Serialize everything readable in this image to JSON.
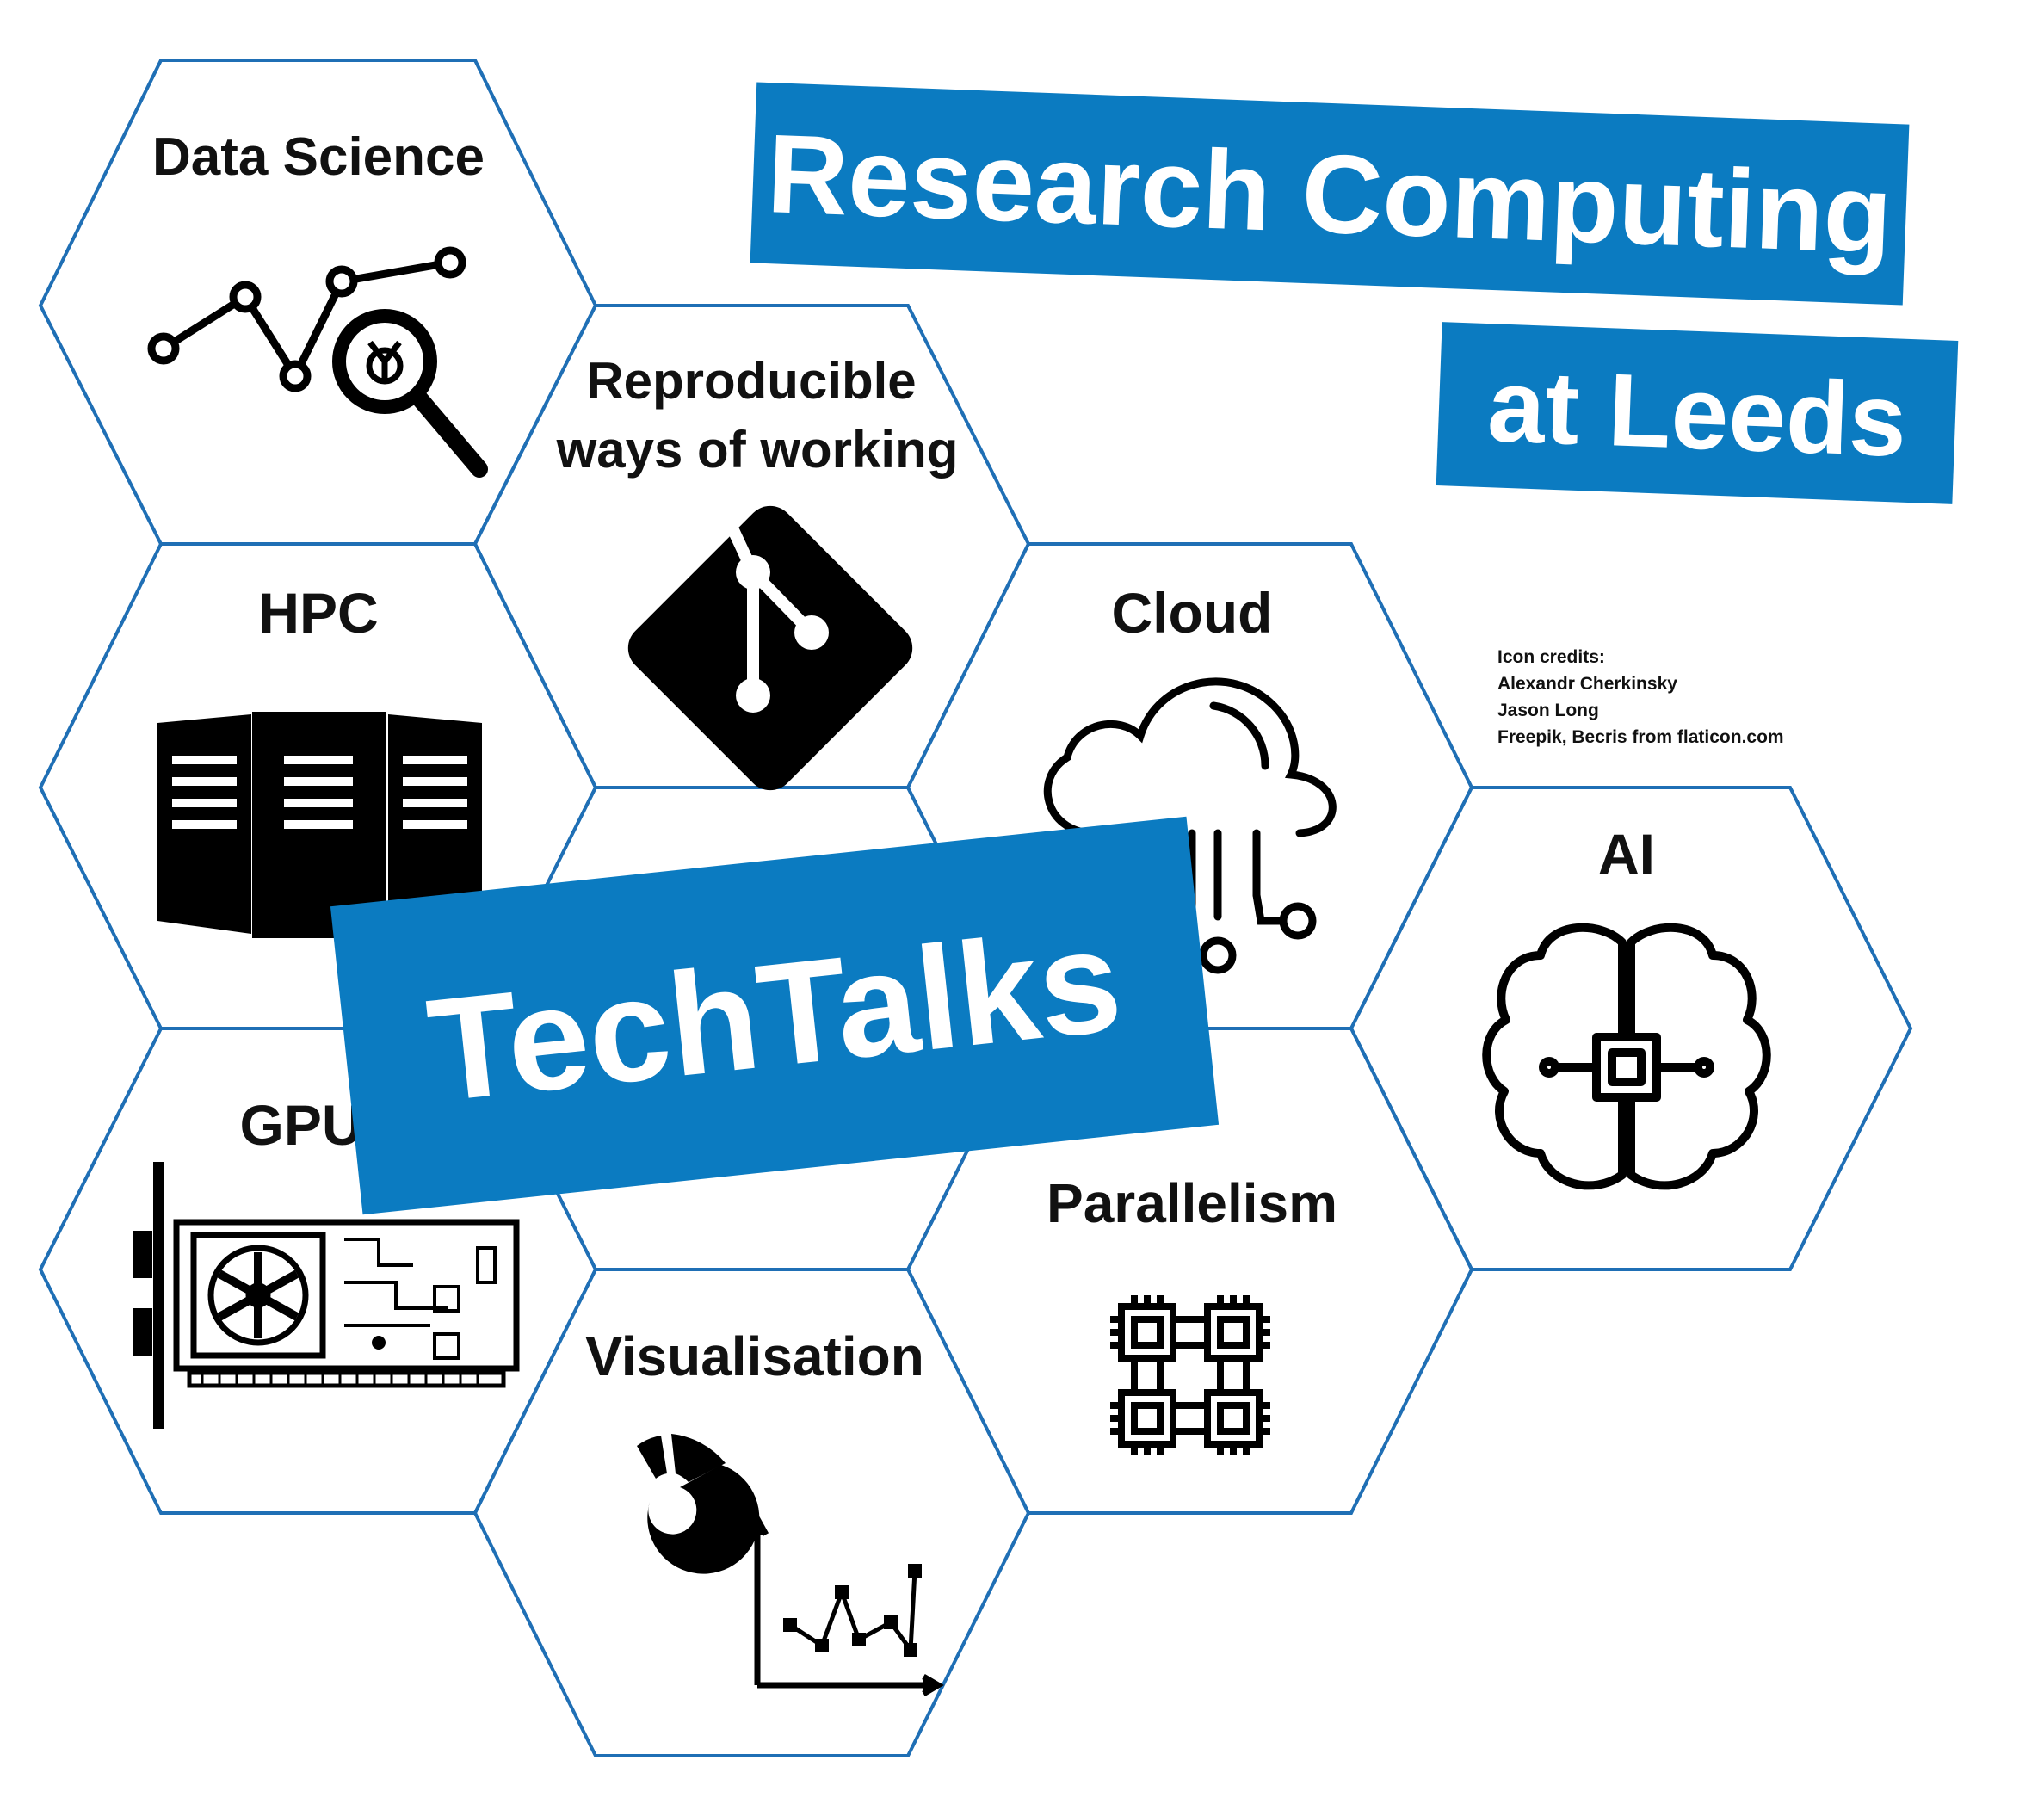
{
  "hexagons": [
    {
      "id": "data-science",
      "label": "Data Science",
      "icon": "data-search-icon"
    },
    {
      "id": "reproducible",
      "label_lines": [
        "Reproducible",
        "ways of working"
      ],
      "icon": "git-icon"
    },
    {
      "id": "hpc",
      "label": "HPC",
      "icon": "server-rack-icon"
    },
    {
      "id": "cloud",
      "label": "Cloud",
      "icon": "cloud-network-icon"
    },
    {
      "id": "ai",
      "label": "AI",
      "icon": "brain-chip-icon"
    },
    {
      "id": "gpu",
      "label": "GPU",
      "icon": "graphics-card-icon"
    },
    {
      "id": "parallelism",
      "label": "Parallelism",
      "icon": "multi-chip-icon"
    },
    {
      "id": "visualisation",
      "label": "Visualisation",
      "icon": "chart-icon"
    }
  ],
  "title_line1": "Research Computing",
  "title_line2": "at Leeds",
  "center_banner": "TechTalks",
  "credits": {
    "lines": [
      "Icon credits:",
      "Alexandr Cherkinsky",
      "Jason Long",
      "Freepik, Becris from flaticon.com"
    ]
  },
  "colors": {
    "accent": "#0b7bc1",
    "hex_stroke": "#1f6fb5",
    "icon": "#000000",
    "text": "#111111"
  }
}
